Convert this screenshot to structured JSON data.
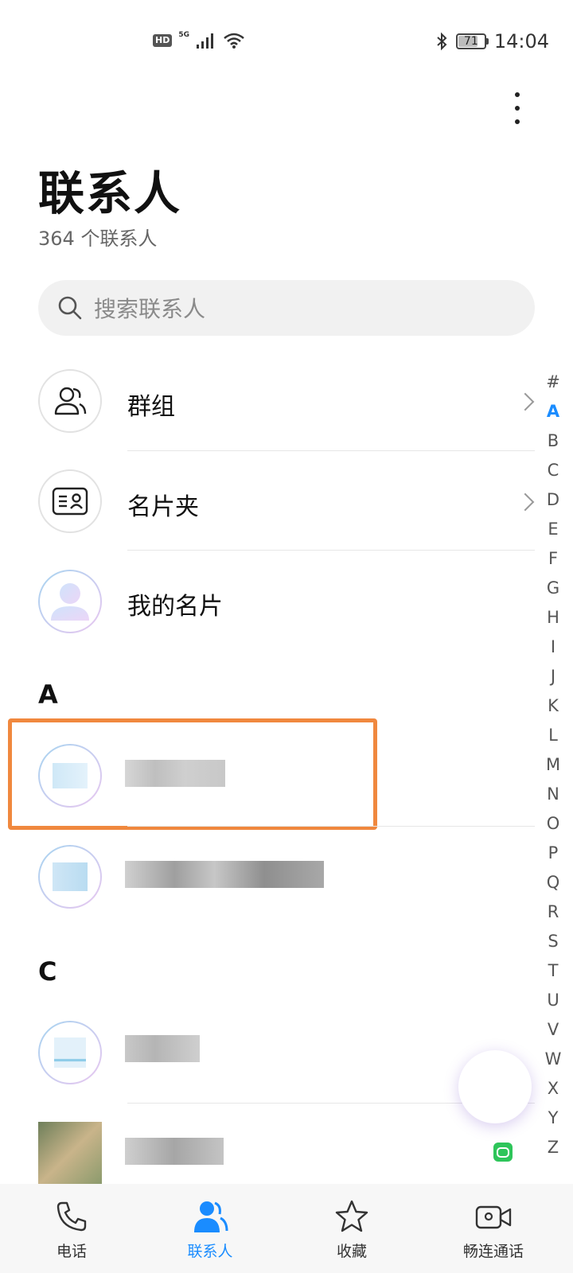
{
  "status_bar": {
    "hd": "HD",
    "network": "5G",
    "battery": "71",
    "time": "14:04"
  },
  "header": {
    "title": "联系人",
    "count": "364 个联系人"
  },
  "search": {
    "placeholder": "搜索联系人"
  },
  "menu": [
    {
      "label": "群组",
      "icon": "group-icon"
    },
    {
      "label": "名片夹",
      "icon": "business-card-icon"
    },
    {
      "label": "我的名片",
      "icon": "profile-avatar-icon"
    }
  ],
  "sections": [
    {
      "letter": "A"
    },
    {
      "letter": "C"
    }
  ],
  "index": [
    "#",
    "A",
    "B",
    "C",
    "D",
    "E",
    "F",
    "G",
    "H",
    "I",
    "J",
    "K",
    "L",
    "M",
    "N",
    "O",
    "P",
    "Q",
    "R",
    "S",
    "T",
    "U",
    "V",
    "W",
    "X",
    "Y",
    "Z"
  ],
  "index_active": "A",
  "nav": [
    {
      "label": "电话",
      "icon": "phone-icon"
    },
    {
      "label": "联系人",
      "icon": "contacts-icon",
      "active": true
    },
    {
      "label": "收藏",
      "icon": "star-icon"
    },
    {
      "label": "畅连通话",
      "icon": "video-call-icon"
    }
  ],
  "colors": {
    "accent": "#1a8cff",
    "highlight_box": "#f0883e",
    "fab_plus": "#8e44d9"
  }
}
